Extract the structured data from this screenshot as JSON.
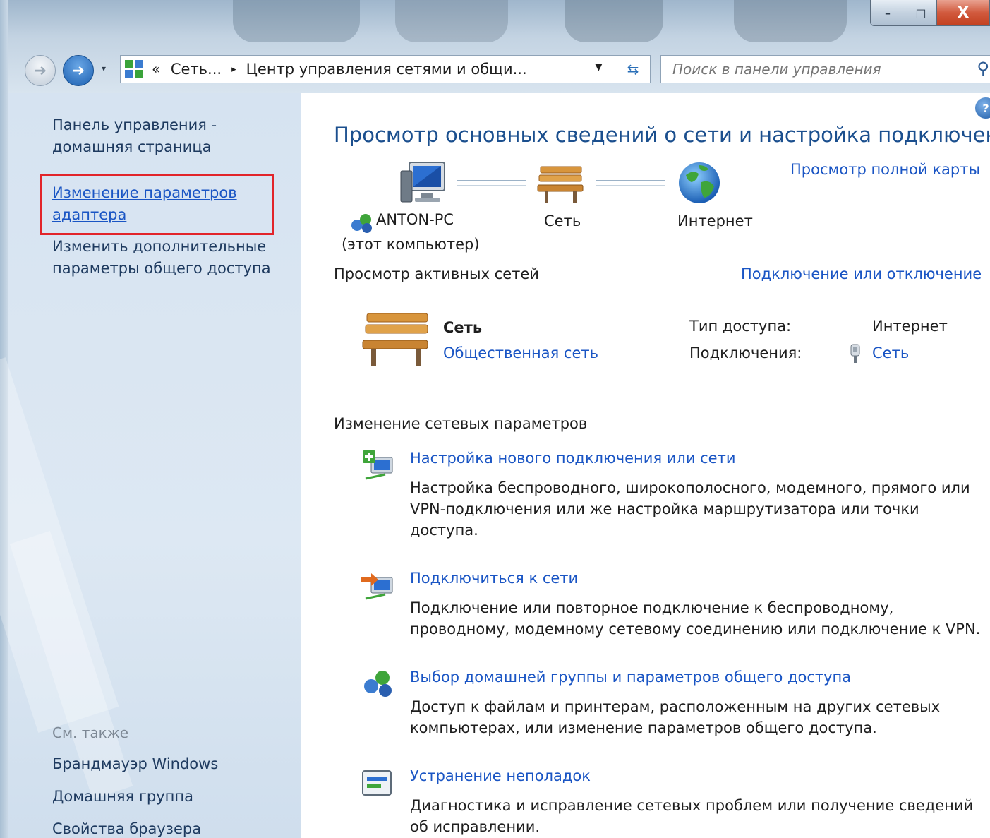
{
  "window": {
    "controls": {
      "minimize": "–",
      "maximize": "□",
      "close": "X"
    }
  },
  "nav": {
    "back_icon": "back-arrow-icon",
    "forward_icon": "forward-arrow-icon",
    "dropdown_glyph": "▾",
    "address": {
      "prefix": "«",
      "crumbs": [
        "Сеть...",
        "Центр управления сетями и общи..."
      ],
      "separator": "▸"
    },
    "search_placeholder": "Поиск в панели управления"
  },
  "sidebar": {
    "home_link": [
      "Панель управления -",
      "домашняя страница"
    ],
    "adapter_link": [
      "Изменение параметров",
      "адаптера"
    ],
    "sharing_link": [
      "Изменить дополнительные",
      "параметры общего доступа"
    ],
    "see_also_title": "См. также",
    "see_also": [
      "Брандмауэр Windows",
      "Домашняя группа",
      "Свойства браузера"
    ]
  },
  "main": {
    "title": "Просмотр основных сведений о сети и настройка подключений",
    "full_map_link": "Просмотр полной карты",
    "map": {
      "computer_name": "ANTON-PC",
      "computer_sub": "(этот компьютер)",
      "network": "Сеть",
      "internet": "Интернет"
    },
    "active": {
      "heading": "Просмотр активных сетей",
      "connect_link": "Подключение или отключение",
      "network_name": "Сеть",
      "network_type": "Общественная сеть",
      "access_label": "Тип доступа:",
      "access_value": "Интернет",
      "connections_label": "Подключения:",
      "connections_value": "Сеть"
    },
    "change": {
      "heading": "Изменение сетевых параметров",
      "tasks": [
        {
          "title": "Настройка нового подключения или сети",
          "desc": [
            "Настройка беспроводного, широкополосного, модемного, прямого или",
            "VPN-подключения или же настройка маршрутизатора или точки",
            "доступа."
          ]
        },
        {
          "title": "Подключиться к сети",
          "desc": [
            "Подключение или повторное подключение к беспроводному,",
            "проводному, модемному сетевому соединению или подключение к VPN."
          ]
        },
        {
          "title": "Выбор домашней группы и параметров общего доступа",
          "desc": [
            "Доступ к файлам и принтерам, расположенным на других сетевых",
            "компьютерах, или изменение параметров общего доступа."
          ]
        },
        {
          "title": "Устранение неполадок",
          "desc": [
            "Диагностика и исправление сетевых проблем или получение сведений",
            "об исправлении."
          ]
        }
      ]
    }
  },
  "colors": {
    "link": "#1a55c4",
    "title": "#1b4f8e",
    "highlight": "#e2242a",
    "sidebar_bg": "#d6e3f1"
  }
}
